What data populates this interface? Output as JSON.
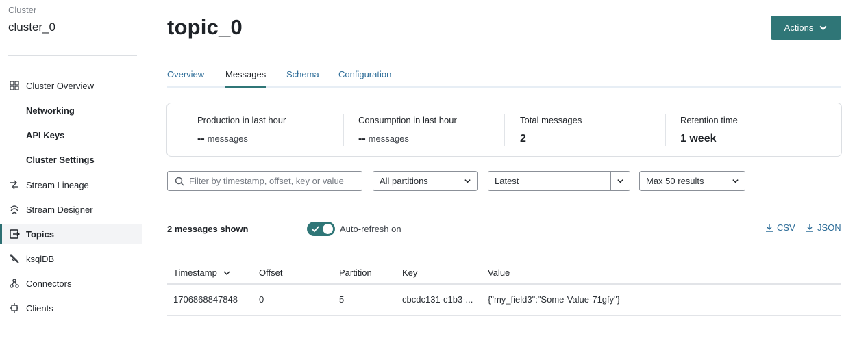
{
  "sidebar": {
    "cluster_caption": "Cluster",
    "cluster_name": "cluster_0",
    "items": [
      {
        "label": "Cluster Overview",
        "icon": "grid-icon"
      },
      {
        "label": "Networking"
      },
      {
        "label": "API Keys"
      },
      {
        "label": "Cluster Settings"
      },
      {
        "label": "Stream Lineage",
        "icon": "lineage-icon"
      },
      {
        "label": "Stream Designer",
        "icon": "designer-icon"
      },
      {
        "label": "Topics",
        "icon": "topics-icon",
        "active": true
      },
      {
        "label": "ksqlDB",
        "icon": "ksqldb-icon"
      },
      {
        "label": "Connectors",
        "icon": "connectors-icon"
      },
      {
        "label": "Clients",
        "icon": "clients-icon"
      }
    ]
  },
  "header": {
    "title": "topic_0",
    "actions_label": "Actions"
  },
  "tabs": [
    {
      "label": "Overview"
    },
    {
      "label": "Messages",
      "active": true
    },
    {
      "label": "Schema"
    },
    {
      "label": "Configuration"
    }
  ],
  "stats": [
    {
      "label": "Production in last hour",
      "value": "--",
      "unit": "messages"
    },
    {
      "label": "Consumption in last hour",
      "value": "--",
      "unit": "messages"
    },
    {
      "label": "Total messages",
      "value": "2"
    },
    {
      "label": "Retention time",
      "value": "1 week"
    }
  ],
  "filters": {
    "search_placeholder": "Filter by timestamp, offset, key or value",
    "partition": "All partitions",
    "offset": "Latest",
    "limit": "Max 50 results"
  },
  "messages": {
    "count_label": "2 messages shown",
    "auto_refresh_label": "Auto-refresh on",
    "auto_refresh_on": true,
    "csv_label": "CSV",
    "json_label": "JSON"
  },
  "table": {
    "columns": [
      "Timestamp",
      "Offset",
      "Partition",
      "Key",
      "Value"
    ],
    "rows": [
      [
        "1706868847848",
        "0",
        "5",
        "cbcdc131-c1b3-...",
        "{\"my_field3\":\"Some-Value-71gfy\"}"
      ]
    ]
  },
  "colors": {
    "accent": "#2f7677",
    "link": "#2f6e99"
  }
}
